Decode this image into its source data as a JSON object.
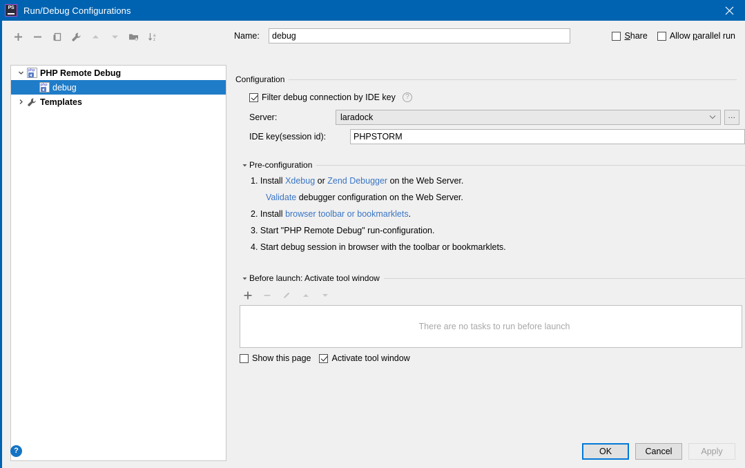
{
  "window": {
    "title": "Run/Debug Configurations",
    "app_icon": "phpstorm-icon",
    "close_icon": "close-icon",
    "titlebar_color": "#0063b1"
  },
  "left_toolbar": {
    "buttons": [
      {
        "name": "add-configuration-button",
        "icon": "plus-icon",
        "label": "+"
      },
      {
        "name": "remove-configuration-button",
        "icon": "minus-icon",
        "label": "−"
      },
      {
        "name": "copy-configuration-button",
        "icon": "copy-icon",
        "label": "Copy"
      },
      {
        "name": "edit-templates-button",
        "icon": "wrench-icon",
        "label": "Edit Templates"
      },
      {
        "name": "move-up-button",
        "icon": "arrow-up-icon",
        "label": "Move Up"
      },
      {
        "name": "move-down-button",
        "icon": "arrow-down-icon",
        "label": "Move Down"
      },
      {
        "name": "create-folder-button",
        "icon": "folder-add-icon",
        "label": "Create Folder"
      },
      {
        "name": "sort-configurations-button",
        "icon": "sort-az-icon",
        "label": "Sort Configurations"
      }
    ]
  },
  "tree": {
    "items": [
      {
        "label": "PHP Remote Debug",
        "icon": "php-remote-debug-icon",
        "arrow": "chevron-down-icon",
        "bold": true,
        "selected": false,
        "level": 0
      },
      {
        "label": "debug",
        "icon": "php-remote-debug-icon",
        "arrow": "",
        "bold": false,
        "selected": true,
        "level": 1
      },
      {
        "label": "Templates",
        "icon": "wrench-icon",
        "arrow": "chevron-right-icon",
        "bold": true,
        "selected": false,
        "level": 0
      }
    ],
    "selection_color": "#1f7cc8"
  },
  "name_row": {
    "label": "Name:",
    "value": "debug",
    "placeholder": ""
  },
  "share": {
    "share_label": "Share",
    "share_checked": false,
    "allow_parallel_label": "Allow parallel run",
    "allow_parallel_checked": false
  },
  "configuration": {
    "section_title": "Configuration",
    "filter_label": "Filter debug connection by IDE key",
    "filter_checked": true,
    "help_icon": "question-mark-icon",
    "server_label": "Server:",
    "server_value": "laradock",
    "browse_label": "...",
    "ide_key_label": "IDE key(session id):",
    "ide_key_value": "PHPSTORM"
  },
  "preconfiguration": {
    "section_title": "Pre-configuration",
    "steps": [
      {
        "number": "1.",
        "parts": [
          {
            "text": "Install ",
            "link": false
          },
          {
            "text": "Xdebug",
            "link": true
          },
          {
            "text": " or ",
            "link": false
          },
          {
            "text": "Zend Debugger",
            "link": true
          },
          {
            "text": " on the Web Server.",
            "link": false
          }
        ]
      },
      {
        "number": "2.",
        "parts": [
          {
            "text": "Install ",
            "link": false
          },
          {
            "text": "browser toolbar or bookmarklets",
            "link": true
          },
          {
            "text": ".",
            "link": false
          }
        ]
      },
      {
        "number": "3.",
        "parts": [
          {
            "text": "Start \"PHP Remote Debug\" run-configuration.",
            "link": false
          }
        ]
      },
      {
        "number": "4.",
        "parts": [
          {
            "text": "Start debug session in browser with the toolbar or bookmarklets.",
            "link": false
          }
        ]
      }
    ],
    "validate_line": {
      "link_text": "Validate",
      "rest_text": " debugger configuration on the Web Server."
    }
  },
  "before_launch": {
    "section_title": "Before launch: Activate tool window",
    "toolbar": [
      {
        "name": "add-task-button",
        "icon": "plus-icon",
        "enabled": true
      },
      {
        "name": "remove-task-button",
        "icon": "minus-icon",
        "enabled": false
      },
      {
        "name": "edit-task-button",
        "icon": "pencil-icon",
        "enabled": false
      },
      {
        "name": "move-task-up-button",
        "icon": "arrow-up-icon",
        "enabled": false
      },
      {
        "name": "move-task-down-button",
        "icon": "arrow-down-icon",
        "enabled": false
      }
    ],
    "empty_text": "There are no tasks to run before launch",
    "show_page_label": "Show this page",
    "show_page_checked": false,
    "activate_tool_window_label": "Activate tool window",
    "activate_tool_window_checked": true
  },
  "footer": {
    "help_icon": "question-mark-icon",
    "help_glyph": "?",
    "ok_label": "OK",
    "cancel_label": "Cancel",
    "apply_label": "Apply",
    "apply_disabled": true,
    "accent_color": "#0078d7"
  }
}
